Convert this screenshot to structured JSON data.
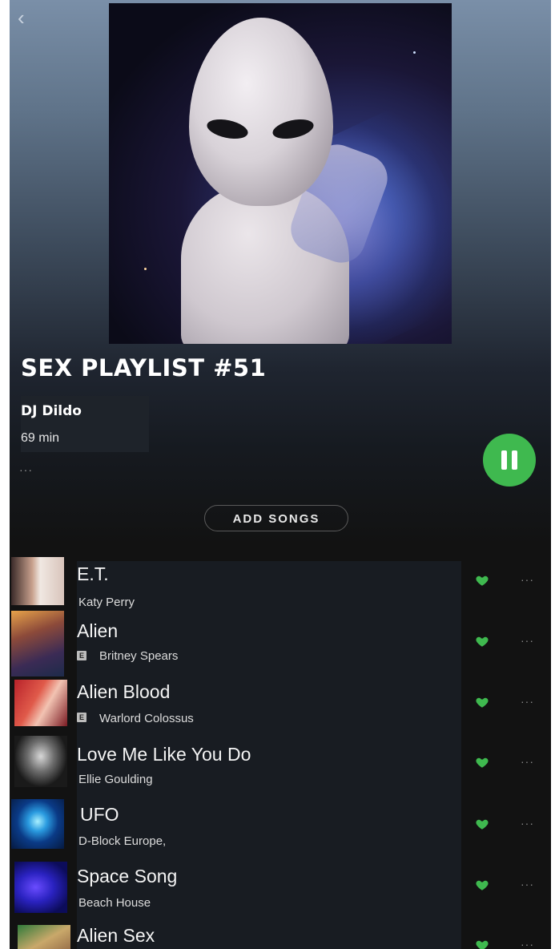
{
  "header": {
    "back_icon": "chevron-left-icon",
    "back_glyph": "‹"
  },
  "playlist": {
    "title": "SEX PLAYLIST #51",
    "owner": "DJ Dildo",
    "duration": "69 min",
    "more_glyph": "···"
  },
  "actions": {
    "add_songs_label": "ADD SONGS",
    "play_state_icon": "pause-icon"
  },
  "colors": {
    "accent": "#3fb94f",
    "background": "#121212"
  },
  "tracks": [
    {
      "title": "E.T.",
      "artist": "Katy Perry",
      "explicit": false,
      "liked": true,
      "more": "···"
    },
    {
      "title": "Alien",
      "artist": "Britney Spears",
      "explicit": true,
      "explicit_label": "E",
      "liked": true,
      "more": "···"
    },
    {
      "title": "Alien Blood",
      "artist": "Warlord Colossus",
      "explicit": true,
      "explicit_label": "E",
      "liked": true,
      "more": "···"
    },
    {
      "title": "Love Me Like You Do",
      "artist": "Ellie Goulding",
      "explicit": false,
      "liked": true,
      "more": "···"
    },
    {
      "title": "UFO",
      "artist": "D-Block Europe,",
      "explicit": false,
      "liked": true,
      "more": "···"
    },
    {
      "title": "Space Song",
      "artist": "Beach House",
      "explicit": false,
      "liked": true,
      "more": "···"
    },
    {
      "title": "Alien Sex",
      "artist": "",
      "explicit": false,
      "liked": true,
      "more": "···"
    }
  ]
}
